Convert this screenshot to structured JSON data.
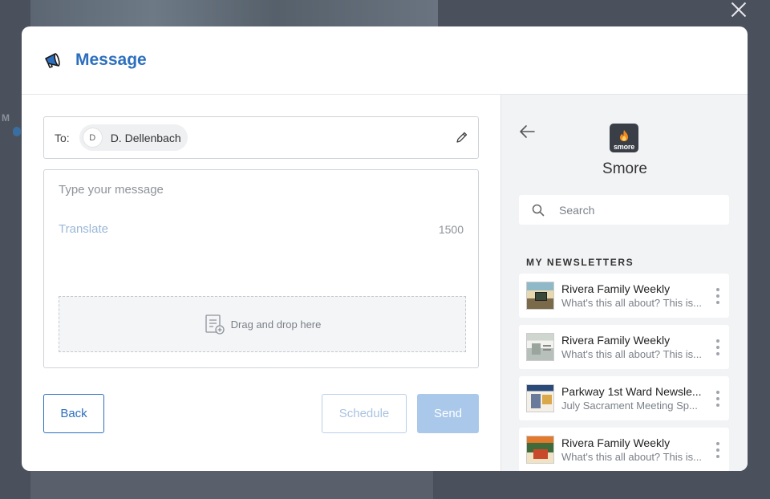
{
  "modal": {
    "title": "Message",
    "icon": "megaphone-icon",
    "accent_color": "#2c6fbe"
  },
  "compose": {
    "to_label": "To:",
    "recipient": {
      "initial": "D",
      "name": "D. Dellenbach"
    },
    "message_placeholder": "Type your message",
    "message_value": "",
    "translate_label": "Translate",
    "char_count": "1500",
    "dropzone_label": "Drag and drop here"
  },
  "actions": {
    "back_label": "Back",
    "schedule_label": "Schedule",
    "send_label": "Send"
  },
  "smore_panel": {
    "logo_text": "smore",
    "name": "Smore",
    "search_placeholder": "Search",
    "section_title": "MY NEWSLETTERS",
    "newsletters": [
      {
        "title": "Rivera Family Weekly",
        "subtitle": "What's this all about? This is..."
      },
      {
        "title": "Rivera Family Weekly",
        "subtitle": "What's this all about? This is..."
      },
      {
        "title": "Parkway 1st Ward Newsle...",
        "subtitle": "July Sacrament Meeting Sp..."
      },
      {
        "title": "Rivera Family Weekly",
        "subtitle": "What's this all about? This is..."
      }
    ]
  }
}
